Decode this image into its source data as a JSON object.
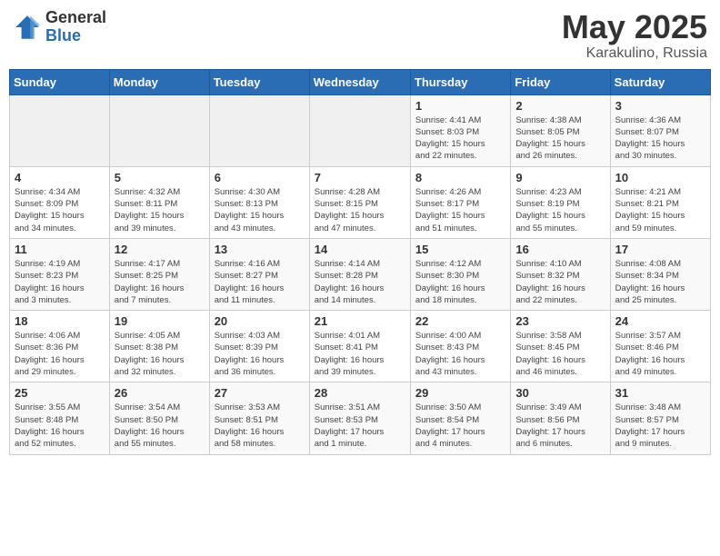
{
  "header": {
    "logo_general": "General",
    "logo_blue": "Blue",
    "title": "May 2025",
    "location": "Karakulino, Russia"
  },
  "weekdays": [
    "Sunday",
    "Monday",
    "Tuesday",
    "Wednesday",
    "Thursday",
    "Friday",
    "Saturday"
  ],
  "weeks": [
    [
      {
        "day": "",
        "info": ""
      },
      {
        "day": "",
        "info": ""
      },
      {
        "day": "",
        "info": ""
      },
      {
        "day": "",
        "info": ""
      },
      {
        "day": "1",
        "info": "Sunrise: 4:41 AM\nSunset: 8:03 PM\nDaylight: 15 hours\nand 22 minutes."
      },
      {
        "day": "2",
        "info": "Sunrise: 4:38 AM\nSunset: 8:05 PM\nDaylight: 15 hours\nand 26 minutes."
      },
      {
        "day": "3",
        "info": "Sunrise: 4:36 AM\nSunset: 8:07 PM\nDaylight: 15 hours\nand 30 minutes."
      }
    ],
    [
      {
        "day": "4",
        "info": "Sunrise: 4:34 AM\nSunset: 8:09 PM\nDaylight: 15 hours\nand 34 minutes."
      },
      {
        "day": "5",
        "info": "Sunrise: 4:32 AM\nSunset: 8:11 PM\nDaylight: 15 hours\nand 39 minutes."
      },
      {
        "day": "6",
        "info": "Sunrise: 4:30 AM\nSunset: 8:13 PM\nDaylight: 15 hours\nand 43 minutes."
      },
      {
        "day": "7",
        "info": "Sunrise: 4:28 AM\nSunset: 8:15 PM\nDaylight: 15 hours\nand 47 minutes."
      },
      {
        "day": "8",
        "info": "Sunrise: 4:26 AM\nSunset: 8:17 PM\nDaylight: 15 hours\nand 51 minutes."
      },
      {
        "day": "9",
        "info": "Sunrise: 4:23 AM\nSunset: 8:19 PM\nDaylight: 15 hours\nand 55 minutes."
      },
      {
        "day": "10",
        "info": "Sunrise: 4:21 AM\nSunset: 8:21 PM\nDaylight: 15 hours\nand 59 minutes."
      }
    ],
    [
      {
        "day": "11",
        "info": "Sunrise: 4:19 AM\nSunset: 8:23 PM\nDaylight: 16 hours\nand 3 minutes."
      },
      {
        "day": "12",
        "info": "Sunrise: 4:17 AM\nSunset: 8:25 PM\nDaylight: 16 hours\nand 7 minutes."
      },
      {
        "day": "13",
        "info": "Sunrise: 4:16 AM\nSunset: 8:27 PM\nDaylight: 16 hours\nand 11 minutes."
      },
      {
        "day": "14",
        "info": "Sunrise: 4:14 AM\nSunset: 8:28 PM\nDaylight: 16 hours\nand 14 minutes."
      },
      {
        "day": "15",
        "info": "Sunrise: 4:12 AM\nSunset: 8:30 PM\nDaylight: 16 hours\nand 18 minutes."
      },
      {
        "day": "16",
        "info": "Sunrise: 4:10 AM\nSunset: 8:32 PM\nDaylight: 16 hours\nand 22 minutes."
      },
      {
        "day": "17",
        "info": "Sunrise: 4:08 AM\nSunset: 8:34 PM\nDaylight: 16 hours\nand 25 minutes."
      }
    ],
    [
      {
        "day": "18",
        "info": "Sunrise: 4:06 AM\nSunset: 8:36 PM\nDaylight: 16 hours\nand 29 minutes."
      },
      {
        "day": "19",
        "info": "Sunrise: 4:05 AM\nSunset: 8:38 PM\nDaylight: 16 hours\nand 32 minutes."
      },
      {
        "day": "20",
        "info": "Sunrise: 4:03 AM\nSunset: 8:39 PM\nDaylight: 16 hours\nand 36 minutes."
      },
      {
        "day": "21",
        "info": "Sunrise: 4:01 AM\nSunset: 8:41 PM\nDaylight: 16 hours\nand 39 minutes."
      },
      {
        "day": "22",
        "info": "Sunrise: 4:00 AM\nSunset: 8:43 PM\nDaylight: 16 hours\nand 43 minutes."
      },
      {
        "day": "23",
        "info": "Sunrise: 3:58 AM\nSunset: 8:45 PM\nDaylight: 16 hours\nand 46 minutes."
      },
      {
        "day": "24",
        "info": "Sunrise: 3:57 AM\nSunset: 8:46 PM\nDaylight: 16 hours\nand 49 minutes."
      }
    ],
    [
      {
        "day": "25",
        "info": "Sunrise: 3:55 AM\nSunset: 8:48 PM\nDaylight: 16 hours\nand 52 minutes."
      },
      {
        "day": "26",
        "info": "Sunrise: 3:54 AM\nSunset: 8:50 PM\nDaylight: 16 hours\nand 55 minutes."
      },
      {
        "day": "27",
        "info": "Sunrise: 3:53 AM\nSunset: 8:51 PM\nDaylight: 16 hours\nand 58 minutes."
      },
      {
        "day": "28",
        "info": "Sunrise: 3:51 AM\nSunset: 8:53 PM\nDaylight: 17 hours\nand 1 minute."
      },
      {
        "day": "29",
        "info": "Sunrise: 3:50 AM\nSunset: 8:54 PM\nDaylight: 17 hours\nand 4 minutes."
      },
      {
        "day": "30",
        "info": "Sunrise: 3:49 AM\nSunset: 8:56 PM\nDaylight: 17 hours\nand 6 minutes."
      },
      {
        "day": "31",
        "info": "Sunrise: 3:48 AM\nSunset: 8:57 PM\nDaylight: 17 hours\nand 9 minutes."
      }
    ]
  ]
}
